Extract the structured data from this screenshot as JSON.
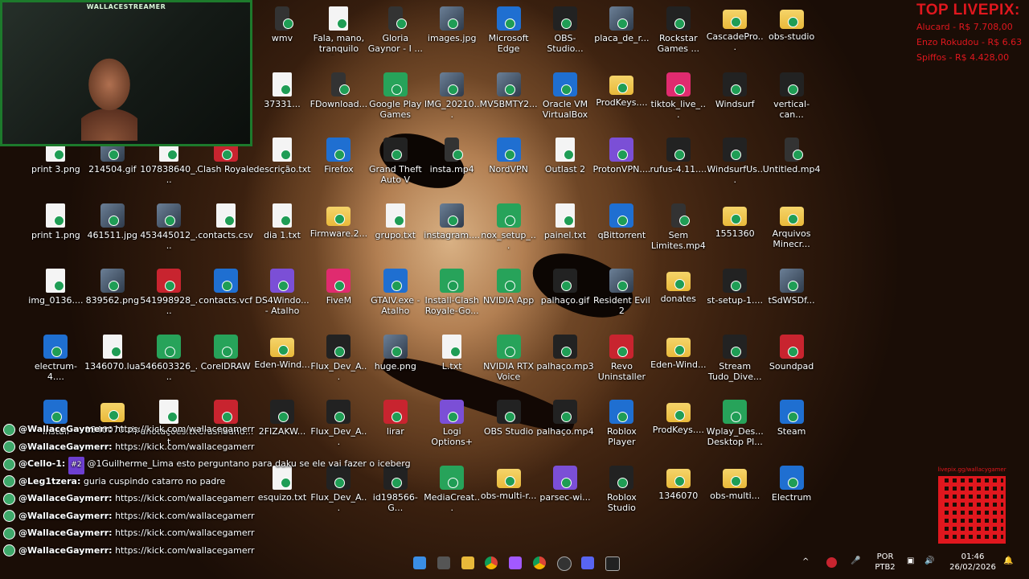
{
  "webcam": {
    "streamer_name": "WALLACESTREAMER"
  },
  "livepix": {
    "title": "TOP LIVEPIX:",
    "entries": [
      "Alucard - R$ 7.708,00",
      "Enzo Rokudou - R$ 6.63",
      "Spiffos - R$ 4.428,00"
    ]
  },
  "desktop": {
    "icons": [
      {
        "label": "wmv",
        "kind": "video",
        "col": 0,
        "row": 0,
        "partial": true
      },
      {
        "label": "Fala, mano, tranquilo fo...",
        "kind": "file",
        "col": 1,
        "row": 0
      },
      {
        "label": "Gloria Gaynor - I ...",
        "kind": "video",
        "col": 2,
        "row": 0
      },
      {
        "label": "images.jpg",
        "kind": "image",
        "col": 3,
        "row": 0
      },
      {
        "label": "Microsoft Edge",
        "kind": "app-blue",
        "col": 4,
        "row": 0
      },
      {
        "label": "OBS-Studio...",
        "kind": "app-dark",
        "col": 5,
        "row": 0
      },
      {
        "label": "placa_de_r...",
        "kind": "image",
        "col": 6,
        "row": 0
      },
      {
        "label": "Rockstar Games ...",
        "kind": "app-dark",
        "col": 7,
        "row": 0
      },
      {
        "label": "CascadePro...",
        "kind": "folder",
        "col": 8,
        "row": 0
      },
      {
        "label": "obs-studio",
        "kind": "folder",
        "col": 9,
        "row": 0
      },
      {
        "label": "37331...",
        "kind": "file",
        "col": 0,
        "row": 1,
        "partial": true
      },
      {
        "label": "FDownload...",
        "kind": "video",
        "col": 1,
        "row": 1
      },
      {
        "label": "Google Play Games",
        "kind": "app-green",
        "col": 2,
        "row": 1
      },
      {
        "label": "IMG_20210...",
        "kind": "image",
        "col": 3,
        "row": 1
      },
      {
        "label": "MV5BMTY2...",
        "kind": "image",
        "col": 4,
        "row": 1
      },
      {
        "label": "Oracle VM VirtualBox",
        "kind": "app-blue",
        "col": 5,
        "row": 1
      },
      {
        "label": "ProdKeys....",
        "kind": "folder",
        "col": 6,
        "row": 1
      },
      {
        "label": "tiktok_live_...",
        "kind": "app-pink",
        "col": 7,
        "row": 1
      },
      {
        "label": "Windsurf",
        "kind": "app-dark",
        "col": 8,
        "row": 1
      },
      {
        "label": "vertical-can...",
        "kind": "app-dark",
        "col": 9,
        "row": 1
      },
      {
        "label": "print 3.png",
        "kind": "file",
        "col": -4,
        "row": 2
      },
      {
        "label": "214504.gif",
        "kind": "image",
        "col": -3,
        "row": 2
      },
      {
        "label": "107838640_...",
        "kind": "file",
        "col": -2,
        "row": 2
      },
      {
        "label": "Clash Royale",
        "kind": "app-red",
        "col": -1,
        "row": 2
      },
      {
        "label": "descrição.txt",
        "kind": "file",
        "col": 0,
        "row": 2
      },
      {
        "label": "Firefox",
        "kind": "app-blue",
        "col": 1,
        "row": 2
      },
      {
        "label": "Grand Theft Auto V",
        "kind": "app-dark",
        "col": 2,
        "row": 2
      },
      {
        "label": "insta.mp4",
        "kind": "video",
        "col": 3,
        "row": 2
      },
      {
        "label": "NordVPN",
        "kind": "app-blue",
        "col": 4,
        "row": 2
      },
      {
        "label": "Outlast 2",
        "kind": "file",
        "col": 5,
        "row": 2
      },
      {
        "label": "ProtonVPN....",
        "kind": "app-purple",
        "col": 6,
        "row": 2
      },
      {
        "label": "rufus-4.11....",
        "kind": "app-dark",
        "col": 7,
        "row": 2
      },
      {
        "label": "WindsurfUs...",
        "kind": "app-dark",
        "col": 8,
        "row": 2
      },
      {
        "label": "Untitled.mp4",
        "kind": "video",
        "col": 9,
        "row": 2
      },
      {
        "label": "print 1.png",
        "kind": "file",
        "col": -4,
        "row": 3
      },
      {
        "label": "461511.jpg",
        "kind": "image",
        "col": -3,
        "row": 3
      },
      {
        "label": "453445012_...",
        "kind": "image",
        "col": -2,
        "row": 3
      },
      {
        "label": "contacts.csv",
        "kind": "file",
        "col": -1,
        "row": 3
      },
      {
        "label": "dia 1.txt",
        "kind": "file",
        "col": 0,
        "row": 3
      },
      {
        "label": "Firmware.2...",
        "kind": "folder",
        "col": 1,
        "row": 3
      },
      {
        "label": "grupo.txt",
        "kind": "file",
        "col": 2,
        "row": 3
      },
      {
        "label": "instagram....",
        "kind": "image",
        "col": 3,
        "row": 3
      },
      {
        "label": "nox_setup_...",
        "kind": "app-green",
        "col": 4,
        "row": 3
      },
      {
        "label": "painel.txt",
        "kind": "file",
        "col": 5,
        "row": 3
      },
      {
        "label": "qBittorrent",
        "kind": "app-blue",
        "col": 6,
        "row": 3
      },
      {
        "label": "Sem Limites.mp4",
        "kind": "video",
        "col": 7,
        "row": 3
      },
      {
        "label": "1551360",
        "kind": "folder",
        "col": 8,
        "row": 3
      },
      {
        "label": "Arquivos Minecr...",
        "kind": "folder",
        "col": 9,
        "row": 3
      },
      {
        "label": "img_0136....",
        "kind": "file",
        "col": -4,
        "row": 4
      },
      {
        "label": "839562.png",
        "kind": "image",
        "col": -3,
        "row": 4
      },
      {
        "label": "541998928_...",
        "kind": "app-red",
        "col": -2,
        "row": 4
      },
      {
        "label": "contacts.vcf",
        "kind": "app-blue",
        "col": -1,
        "row": 4
      },
      {
        "label": "DS4Windo... - Atalho",
        "kind": "app-purple",
        "col": 0,
        "row": 4
      },
      {
        "label": "FiveM",
        "kind": "app-pink",
        "col": 1,
        "row": 4
      },
      {
        "label": "GTAIV.exe - Atalho",
        "kind": "app-blue",
        "col": 2,
        "row": 4
      },
      {
        "label": "Install-Clash Royale-Go...",
        "kind": "app-green",
        "col": 3,
        "row": 4
      },
      {
        "label": "NVIDIA App",
        "kind": "app-green",
        "col": 4,
        "row": 4
      },
      {
        "label": "palhaço.gif",
        "kind": "app-dark",
        "col": 5,
        "row": 4
      },
      {
        "label": "Resident Evil 2",
        "kind": "image",
        "col": 6,
        "row": 4
      },
      {
        "label": "donates",
        "kind": "folder",
        "col": 7,
        "row": 4
      },
      {
        "label": "st-setup-1....",
        "kind": "app-dark",
        "col": 8,
        "row": 4
      },
      {
        "label": "tSdWSDf...",
        "kind": "image",
        "col": 9,
        "row": 4
      },
      {
        "label": "electrum-4....",
        "kind": "app-blue",
        "col": -4,
        "row": 5
      },
      {
        "label": "1346070.lua",
        "kind": "file",
        "col": -3,
        "row": 5
      },
      {
        "label": "546603326_...",
        "kind": "app-green",
        "col": -2,
        "row": 5
      },
      {
        "label": "CorelDRAW",
        "kind": "app-green",
        "col": -1,
        "row": 5
      },
      {
        "label": "Eden-Wind...",
        "kind": "folder",
        "col": 0,
        "row": 5
      },
      {
        "label": "Flux_Dev_A...",
        "kind": "app-dark",
        "col": 1,
        "row": 5
      },
      {
        "label": "huge.png",
        "kind": "image",
        "col": 2,
        "row": 5
      },
      {
        "label": "L.txt",
        "kind": "file",
        "col": 3,
        "row": 5
      },
      {
        "label": "NVIDIA RTX Voice",
        "kind": "app-green",
        "col": 4,
        "row": 5
      },
      {
        "label": "palhaço.mp3",
        "kind": "app-dark",
        "col": 5,
        "row": 5
      },
      {
        "label": "Revo Uninstaller",
        "kind": "app-red",
        "col": 6,
        "row": 5
      },
      {
        "label": "Eden-Wind...",
        "kind": "folder",
        "col": 7,
        "row": 5
      },
      {
        "label": "Stream Tudo_Dive...",
        "kind": "app-dark",
        "col": 8,
        "row": 5
      },
      {
        "label": "Soundpad",
        "kind": "app-red",
        "col": 9,
        "row": 5
      },
      {
        "label": "Install",
        "kind": "app-blue",
        "col": -4,
        "row": 6
      },
      {
        "label": "1346070.zip",
        "kind": "folder",
        "col": -3,
        "row": 6
      },
      {
        "label": "anotações.txt",
        "kind": "file",
        "col": -2,
        "row": 6
      },
      {
        "label": "Crashband...",
        "kind": "app-red",
        "col": -1,
        "row": 6
      },
      {
        "label": "2FIZAKW...",
        "kind": "app-dark",
        "col": 0,
        "row": 6
      },
      {
        "label": "Flux_Dev_A...",
        "kind": "app-dark",
        "col": 1,
        "row": 6
      },
      {
        "label": "lirar",
        "kind": "app-red",
        "col": 2,
        "row": 6
      },
      {
        "label": "Logi Options+",
        "kind": "app-purple",
        "col": 3,
        "row": 6
      },
      {
        "label": "OBS Studio",
        "kind": "app-dark",
        "col": 4,
        "row": 6
      },
      {
        "label": "palhaço.mp4",
        "kind": "app-dark",
        "col": 5,
        "row": 6
      },
      {
        "label": "Roblox Player",
        "kind": "app-blue",
        "col": 6,
        "row": 6
      },
      {
        "label": "ProdKeys....",
        "kind": "folder",
        "col": 7,
        "row": 6
      },
      {
        "label": "Wplay_Des... Desktop Pl...",
        "kind": "app-green",
        "col": 8,
        "row": 6
      },
      {
        "label": "Steam",
        "kind": "app-blue",
        "col": 9,
        "row": 6
      },
      {
        "label": "esquizo.txt",
        "kind": "file",
        "col": 0,
        "row": 7
      },
      {
        "label": "Flux_Dev_A...",
        "kind": "app-dark",
        "col": 1,
        "row": 7
      },
      {
        "label": "id198566-G...",
        "kind": "app-dark",
        "col": 2,
        "row": 7
      },
      {
        "label": "MediaCreat...",
        "kind": "app-green",
        "col": 3,
        "row": 7
      },
      {
        "label": "obs-multi-r...",
        "kind": "folder",
        "col": 4,
        "row": 7
      },
      {
        "label": "parsec-wi...",
        "kind": "app-purple",
        "col": 5,
        "row": 7
      },
      {
        "label": "Roblox Studio",
        "kind": "app-dark",
        "col": 6,
        "row": 7
      },
      {
        "label": "1346070",
        "kind": "folder",
        "col": 7,
        "row": 7
      },
      {
        "label": "obs-multi...",
        "kind": "folder",
        "col": 8,
        "row": 7
      },
      {
        "label": "Electrum",
        "kind": "app-blue",
        "col": 9,
        "row": 7
      }
    ]
  },
  "chat": {
    "lines": [
      {
        "user": "@WallaceGaymerr:",
        "text": "https://kick.com/wallacegamerr",
        "badge": "verified"
      },
      {
        "user": "@WallaceGaymerr:",
        "text": "https://kick.com/wallacegamerr",
        "badge": "verified"
      },
      {
        "user": "@Cello-1:",
        "sub": "#2",
        "text": "@1Guilherme_Lima esto perguntano para daku se ele vai fazer o iceberg",
        "badge": "sub"
      },
      {
        "user": "@Leg1tzera:",
        "text": "guria cuspindo catarro no padre",
        "badge": "sub"
      },
      {
        "user": "@WallaceGaymerr:",
        "text": "https://kick.com/wallacegamerr",
        "badge": "verified"
      },
      {
        "user": "@WallaceGaymerr:",
        "text": "https://kick.com/wallacegamerr",
        "badge": "verified"
      },
      {
        "user": "@WallaceGaymerr:",
        "text": "https://kick.com/wallacegamerr",
        "badge": "verified"
      },
      {
        "user": "@WallaceGaymerr:",
        "text": "https://kick.com/wallacegamerr",
        "badge": "verified"
      }
    ]
  },
  "qr": {
    "url": "livepix.gg/wallacygamer"
  },
  "taskbar": {
    "apps": [
      "start-icon",
      "task-view-icon",
      "file-explorer-icon",
      "chrome-icon",
      "figma-icon",
      "chrome-alt-icon",
      "obs-icon",
      "discord-icon",
      "terminal-icon"
    ],
    "language": "POR",
    "keyboard": "PTB2",
    "time": "01:46",
    "date": "26/02/2026"
  },
  "colors": {
    "accent_red": "#e0171e",
    "webcam_border": "#1d7a2c"
  }
}
